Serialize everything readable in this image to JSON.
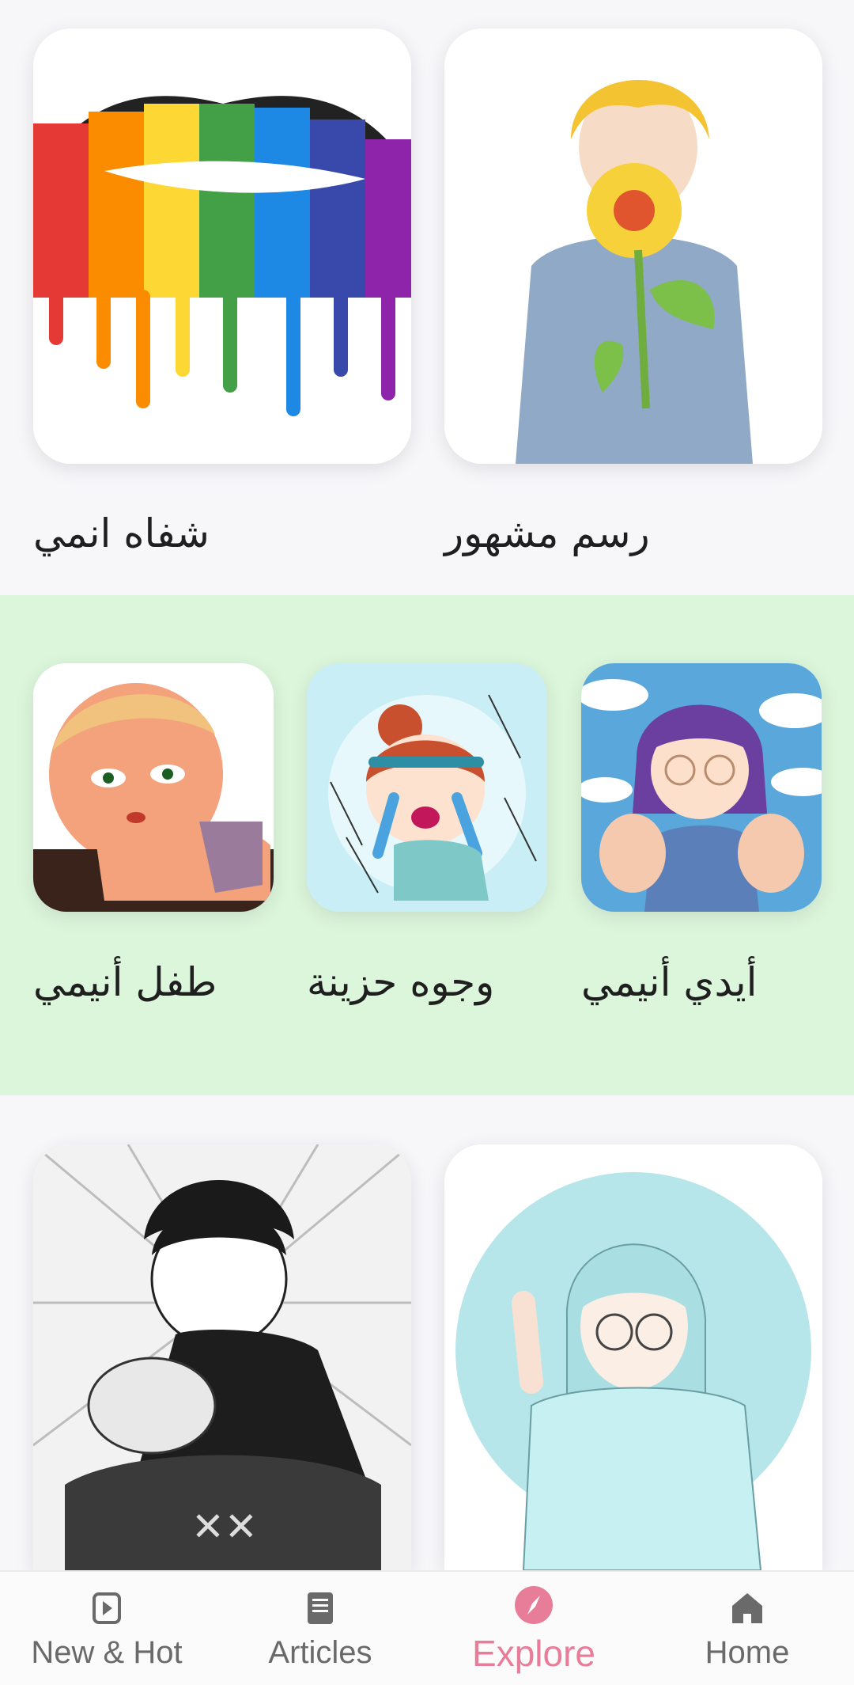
{
  "cards": {
    "anime_lips": {
      "label": "شفاه انمي"
    },
    "famous_drawing": {
      "label": "رسم مشهور"
    },
    "anime_baby": {
      "label": "طفل أنيمي"
    },
    "sad_faces": {
      "label": "وجوه حزينة"
    },
    "anime_hands": {
      "label": "أيدي أنيمي"
    },
    "manga_boy": {
      "label": ""
    },
    "anime_girl_glasses": {
      "label": ""
    }
  },
  "nav": {
    "items": [
      {
        "label": "New & Hot",
        "icon": "play-icon",
        "active": false
      },
      {
        "label": "Articles",
        "icon": "book-icon",
        "active": false
      },
      {
        "label": "Explore",
        "icon": "compass-icon",
        "active": true
      },
      {
        "label": "Home",
        "icon": "home-icon",
        "active": false
      }
    ]
  },
  "colors": {
    "accent": "#e77d98",
    "mid_section_bg": "#dcf6dc",
    "nav_inactive": "#6a6a6a"
  }
}
